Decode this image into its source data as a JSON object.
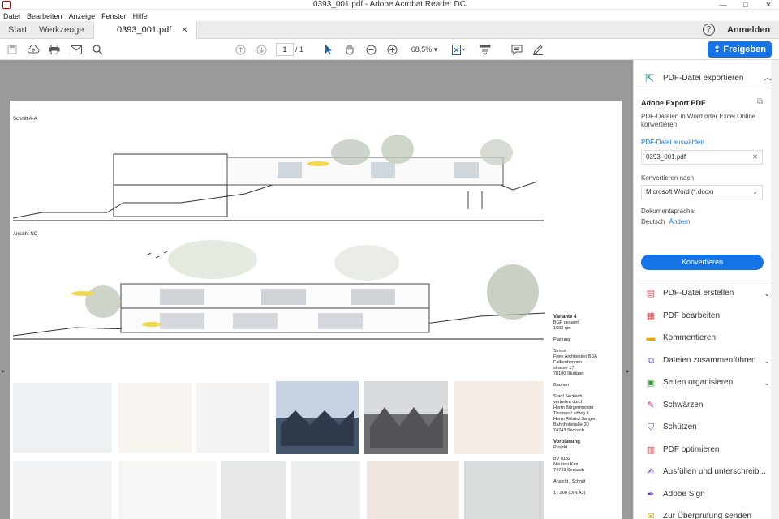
{
  "window": {
    "title": "0393_001.pdf - Adobe Acrobat Reader DC",
    "controls": [
      "—",
      "□",
      "✕"
    ]
  },
  "menu": [
    "Datei",
    "Bearbeiten",
    "Anzeige",
    "Fenster",
    "Hilfe"
  ],
  "tabs": {
    "start": "Start",
    "tools": "Werkzeuge",
    "doc": "0393_001.pdf",
    "help": "?",
    "signin": "Anmelden"
  },
  "toolbar": {
    "page_current": "1",
    "page_total": "/ 1",
    "zoom": "68,5%",
    "share": "Freigeben"
  },
  "document": {
    "section_a": "Schnitt A-A",
    "section_no": "Ansicht NO",
    "variant": "Variante 4",
    "bgf": [
      "BGF gesamt:",
      "1693 qm"
    ],
    "planning_label": "Planung",
    "planning": [
      "Simon",
      "Freie Architekten BDA",
      "Falbenhennen-",
      "strasse 17",
      "70180 Stuttgart"
    ],
    "client_label": "Bauherr",
    "client": [
      "Stadt Seckach",
      "vertreten durch",
      "Herrn Bürgermeister",
      "Thomas Ludwig &",
      "Herrn Roland Sangert",
      "Bahnhofstraße 30",
      "74743 Seckach"
    ],
    "phase_label": "Vorplanung",
    "project_label": "Projekt",
    "project": [
      "BV 0182",
      "Neubau Kita",
      "74743 Seckach"
    ],
    "drawing": "Ansicht / Schnitt",
    "scale": "1 : 200 (DIN A3)"
  },
  "panel": {
    "export_title": "PDF-Datei exportieren",
    "adobe_export": "Adobe Export PDF",
    "desc": "PDF-Dateien in Word oder Excel Online konvertieren",
    "choose_file": "PDF-Datei auswählen",
    "file_name": "0393_001.pdf",
    "convert_to": "Konvertieren nach",
    "format": "Microsoft Word (*.docx)",
    "doc_lang_label": "Dokumentsprache:",
    "doc_lang": "Deutsch",
    "change": "Ändern",
    "convert": "Konvertieren",
    "tools": [
      {
        "label": "PDF-Datei erstellen",
        "icon": "create-pdf-icon",
        "color": "#e34850",
        "chevron": true
      },
      {
        "label": "PDF bearbeiten",
        "icon": "edit-pdf-icon",
        "color": "#e34850",
        "chevron": false
      },
      {
        "label": "Kommentieren",
        "icon": "comment-icon",
        "color": "#e8a800",
        "chevron": false
      },
      {
        "label": "Dateien zusammenführen",
        "icon": "combine-files-icon",
        "color": "#4b50c8",
        "chevron": true
      },
      {
        "label": "Seiten organisieren",
        "icon": "organize-pages-icon",
        "color": "#3a9a3a",
        "chevron": true
      },
      {
        "label": "Schwärzen",
        "icon": "redact-icon",
        "color": "#c0308a",
        "chevron": false
      },
      {
        "label": "Schützen",
        "icon": "protect-icon",
        "color": "#4b50c8",
        "chevron": false
      },
      {
        "label": "PDF optimieren",
        "icon": "optimize-pdf-icon",
        "color": "#e34850",
        "chevron": false
      },
      {
        "label": "Ausfüllen und unterschreib...",
        "icon": "fill-sign-icon",
        "color": "#7a3ac0",
        "chevron": false
      },
      {
        "label": "Adobe Sign",
        "icon": "adobe-sign-icon",
        "color": "#7a3ac0",
        "chevron": false
      },
      {
        "label": "Zur Überprüfung senden",
        "icon": "send-review-icon",
        "color": "#e8a800",
        "chevron": false
      }
    ]
  }
}
